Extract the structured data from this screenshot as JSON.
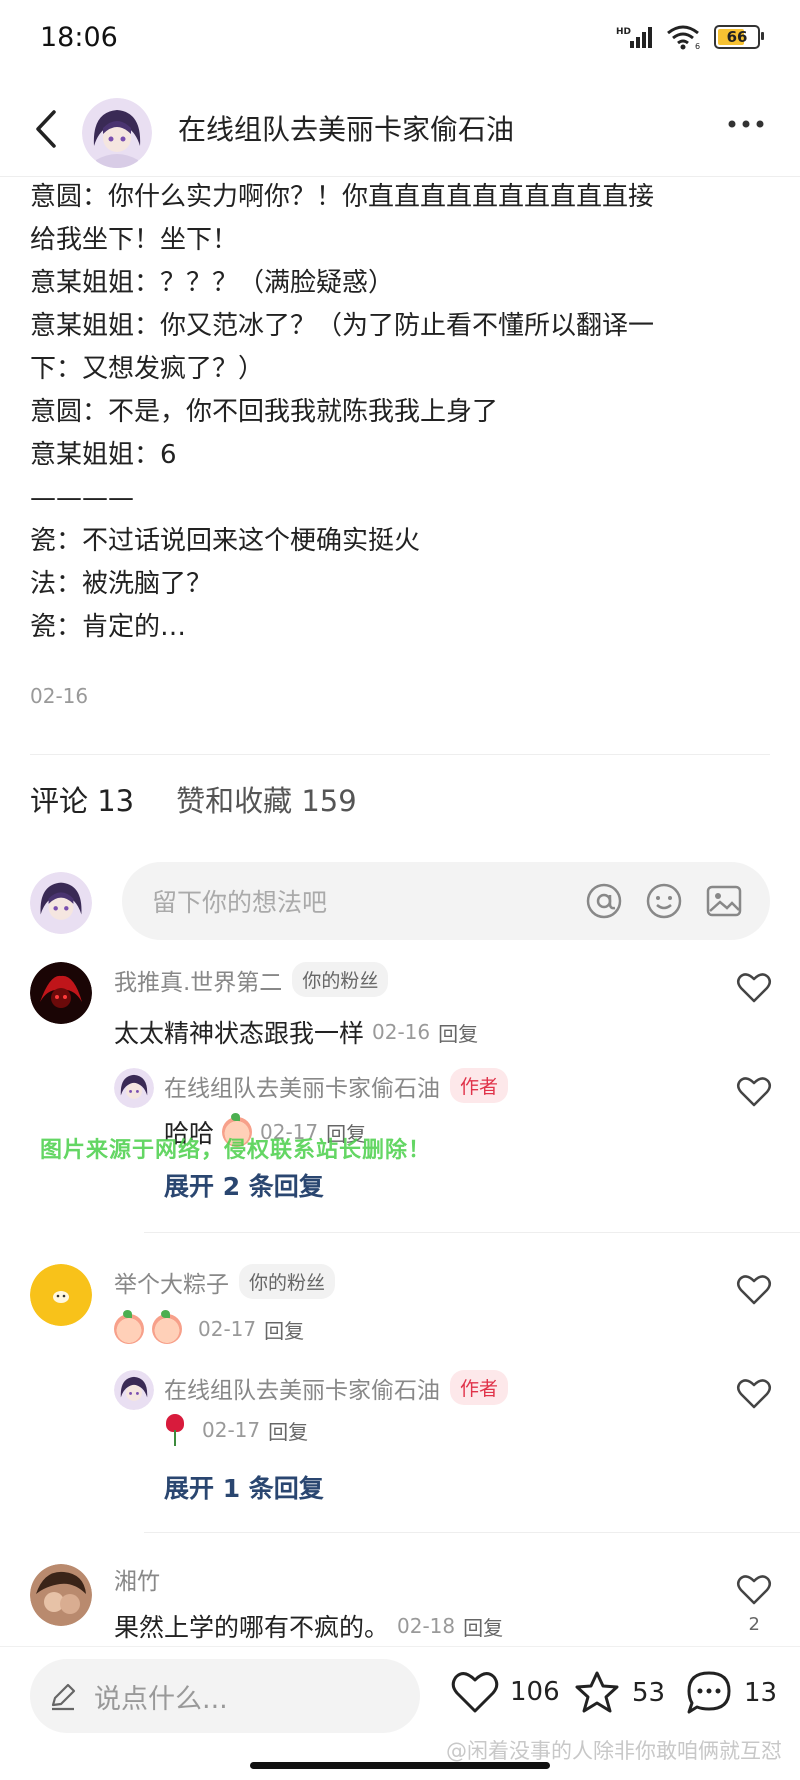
{
  "status": {
    "time": "18:06",
    "battery": "66",
    "signal_label": "HD",
    "wifi_label": "6"
  },
  "header": {
    "title": "在线组队去美丽卡家偷石油"
  },
  "post": {
    "lines": [
      "意圆：你什么实力啊你？！你直直直直直直直直直直接",
      "给我坐下！坐下！",
      "意某姐姐：？？？（满脸疑惑）",
      "意某姐姐：你又范冰了？（为了防止看不懂所以翻译一",
      "下：又想发疯了？）",
      "意圆：不是，你不回我我就陈我我上身了",
      "意某姐姐：6",
      "————",
      "瓷：不过话说回来这个梗确实挺火",
      "法：被洗脑了？",
      "瓷：肯定的…"
    ],
    "date": "02-16"
  },
  "tabs": {
    "comments": "评论 13",
    "likes": "赞和收藏 159"
  },
  "comment_input": {
    "placeholder": "留下你的想法吧"
  },
  "comments": [
    {
      "name": "我推真.世界第二",
      "badge": "你的粉丝",
      "text": "太太精神状态跟我一样",
      "date": "02-16",
      "reply": "回复",
      "sub": {
        "name": "在线组队去美丽卡家偷石油",
        "badge": "作者",
        "text": "哈哈",
        "date": "02-17",
        "reply": "回复"
      },
      "expand": "展开 2 条回复"
    },
    {
      "name": "举个大粽子",
      "badge": "你的粉丝",
      "text": "",
      "date": "02-17",
      "reply": "回复",
      "sub": {
        "name": "在线组队去美丽卡家偷石油",
        "badge": "作者",
        "text": "",
        "date": "02-17",
        "reply": "回复"
      },
      "expand": "展开 1 条回复"
    },
    {
      "name": "湘竹",
      "badge": "",
      "text": "果然上学的哪有不疯的。",
      "date": "02-18",
      "reply": "回复",
      "likes": "2"
    }
  ],
  "overlay_watermark": "图片来源于网络，侵权联系站长删除！",
  "bottom": {
    "placeholder": "说点什么...",
    "likes": "106",
    "stars": "53",
    "comments": "13",
    "watermark": "@闲着没事的人除非你敢咱俩就互怼"
  }
}
